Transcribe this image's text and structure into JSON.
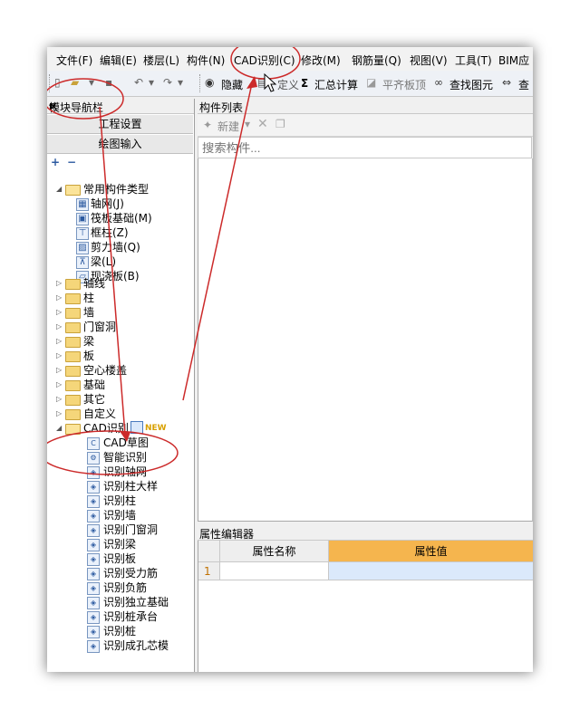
{
  "menubar": {
    "items": [
      "文件(F)",
      "编辑(E)",
      "楼层(L)",
      "构件(N)",
      "CAD识别(C)",
      "修改(M)",
      "钢筋量(Q)",
      "视图(V)",
      "工具(T)",
      "BIM应"
    ]
  },
  "toolbar": {
    "hide_label": "隐藏",
    "custom_label": "定义",
    "summary_label": "汇总计算",
    "flat_label": "平齐板顶",
    "find_label": "查找图元",
    "query_label": "查"
  },
  "nav": {
    "title": "模块导航栏",
    "pin": "ᵽ",
    "close": "×",
    "btn_project": "工程设置",
    "btn_drawing": "绘图输入",
    "expand_all": "+",
    "collapse_all": "−",
    "tree": {
      "common": "常用构件类型",
      "common_children": [
        "轴网(J)",
        "筏板基础(M)",
        "框柱(Z)",
        "剪力墙(Q)",
        "梁(L)",
        "现浇板(B)"
      ],
      "folders": [
        "轴线",
        "柱",
        "墙",
        "门窗洞",
        "梁",
        "板",
        "空心楼盖",
        "基础",
        "其它",
        "自定义"
      ],
      "cad": "CAD识别",
      "cad_badge": "NEW",
      "cad_children": [
        "CAD草图",
        "智能识别",
        "识别轴网",
        "识别柱大样",
        "识别柱",
        "识别墙",
        "识别门窗洞",
        "识别梁",
        "识别板",
        "识别受力筋",
        "识别负筋",
        "识别独立基础",
        "识别桩承台",
        "识别桩",
        "识别成孔芯模"
      ]
    }
  },
  "list": {
    "title": "构件列表",
    "new_label": "新建",
    "search_placeholder": "搜索构件..."
  },
  "props": {
    "title": "属性编辑器",
    "col_name": "属性名称",
    "col_value": "属性值",
    "row_number": "1"
  },
  "colors": {
    "annotation_red": "#cc2a2a",
    "value_header": "#f5b54e",
    "selected_row": "#dbe9fb"
  }
}
